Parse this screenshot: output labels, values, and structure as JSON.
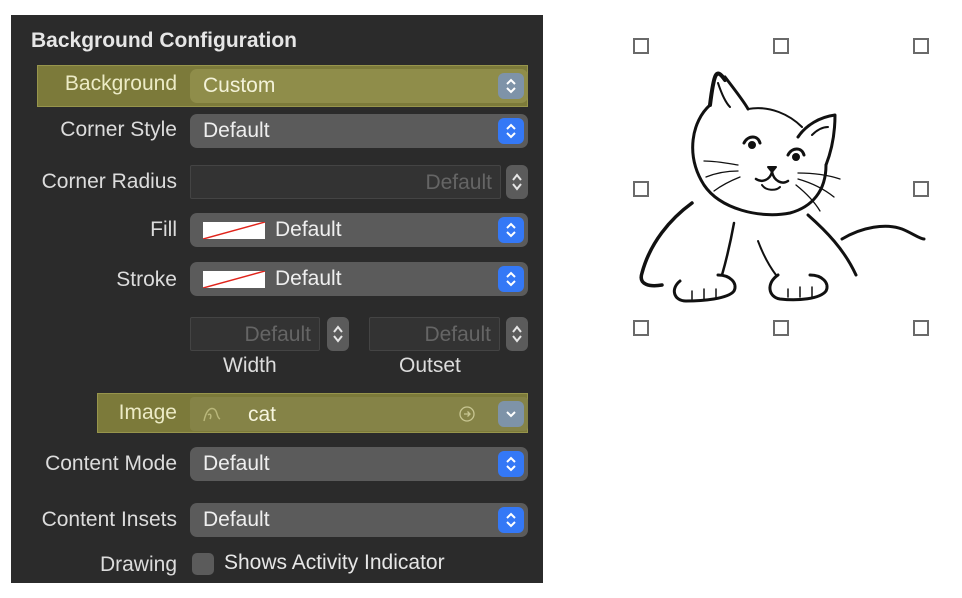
{
  "panel": {
    "title": "Background Configuration",
    "rows": {
      "background": {
        "label": "Background",
        "value": "Custom"
      },
      "corner_style": {
        "label": "Corner Style",
        "value": "Default"
      },
      "corner_radius": {
        "label": "Corner Radius",
        "placeholder": "Default"
      },
      "fill": {
        "label": "Fill",
        "value": "Default"
      },
      "stroke": {
        "label": "Stroke",
        "value": "Default"
      },
      "width": {
        "placeholder": "Default",
        "label": "Width"
      },
      "outset": {
        "placeholder": "Default",
        "label": "Outset"
      },
      "image": {
        "label": "Image",
        "value": "cat"
      },
      "content_mode": {
        "label": "Content Mode",
        "value": "Default"
      },
      "content_insets": {
        "label": "Content Insets",
        "value": "Default"
      },
      "drawing": {
        "label": "Drawing",
        "checkbox_label": "Shows Activity Indicator"
      }
    }
  },
  "canvas": {
    "image_name": "cat-drawing"
  },
  "colors": {
    "panel_bg": "#2b2b2b",
    "highlight": "#7c7a3a",
    "accent": "#3478f6",
    "popup_bg": "#5b5b5b"
  }
}
